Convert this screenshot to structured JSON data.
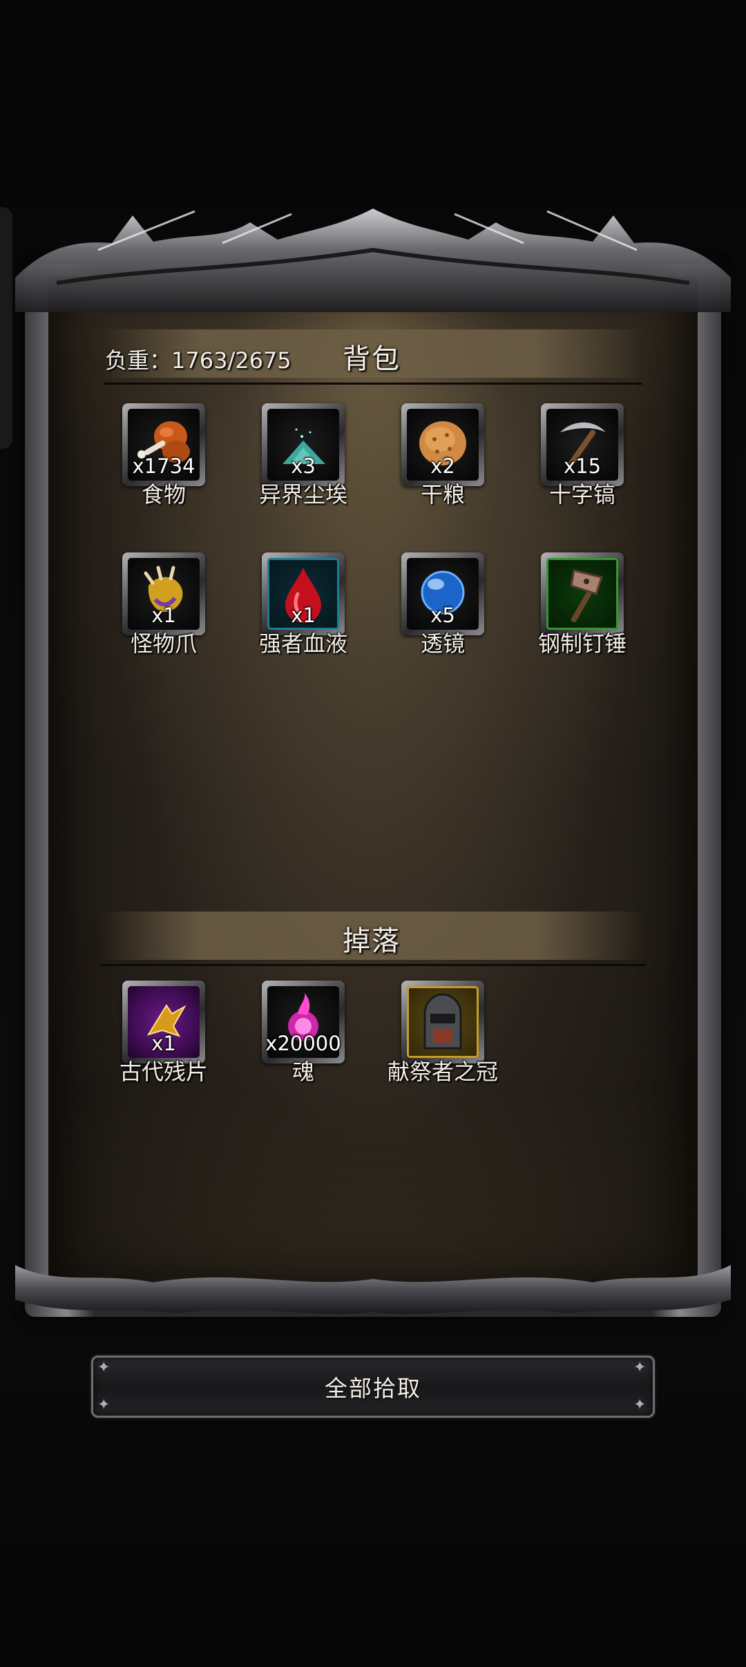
{
  "backpack": {
    "title": "背包",
    "weight_label": "负重：1763/2675",
    "items": [
      {
        "name": "食物",
        "qty": "x1734",
        "icon": "drumstick-icon",
        "rarity": "normal"
      },
      {
        "name": "异界尘埃",
        "qty": "x3",
        "icon": "dust-pile-icon",
        "rarity": "normal"
      },
      {
        "name": "干粮",
        "qty": "x2",
        "icon": "biscuit-icon",
        "rarity": "normal"
      },
      {
        "name": "十字镐",
        "qty": "x15",
        "icon": "pickaxe-icon",
        "rarity": "normal"
      },
      {
        "name": "怪物爪",
        "qty": "x1",
        "icon": "monster-claw-icon",
        "rarity": "normal"
      },
      {
        "name": "强者血液",
        "qty": "x1",
        "icon": "blood-drop-icon",
        "rarity": "rare"
      },
      {
        "name": "透镜",
        "qty": "x5",
        "icon": "lens-orb-icon",
        "rarity": "normal"
      },
      {
        "name": "钢制钉锤",
        "qty": "",
        "icon": "steel-mace-icon",
        "rarity": "uncommon"
      }
    ]
  },
  "drops": {
    "title": "掉落",
    "items": [
      {
        "name": "古代残片",
        "qty": "x1",
        "icon": "ancient-shard-icon",
        "rarity": "epic"
      },
      {
        "name": "魂",
        "qty": "x20000",
        "icon": "soul-flame-icon",
        "rarity": "normal"
      },
      {
        "name": "献祭者之冠",
        "qty": "",
        "icon": "helmet-icon",
        "rarity": "legendary"
      }
    ]
  },
  "actions": {
    "pick_all_label": "全部拾取"
  },
  "colors": {
    "text": "#f3efe6",
    "rare_border": "#1e7c96",
    "uncommon_border": "#2f9a2f",
    "epic_bg": "#6a1c88",
    "legendary_border": "#c79b2a"
  }
}
